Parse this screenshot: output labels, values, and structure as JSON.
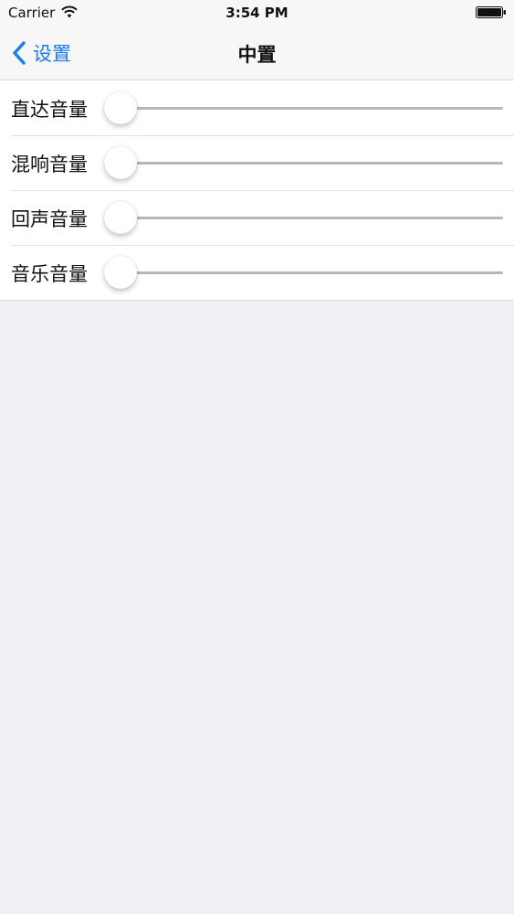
{
  "status_bar": {
    "carrier": "Carrier",
    "time": "3:54 PM",
    "wifi_icon": "wifi-icon",
    "battery_icon": "battery-icon"
  },
  "nav": {
    "back_label": "设置",
    "back_icon": "chevron-left-icon",
    "title": "中置",
    "accent_color": "#1a7cf2"
  },
  "settings": {
    "rows": [
      {
        "label": "直达音量",
        "value": 0
      },
      {
        "label": "混响音量",
        "value": 0
      },
      {
        "label": "回声音量",
        "value": 0
      },
      {
        "label": "音乐音量",
        "value": 0
      }
    ]
  }
}
